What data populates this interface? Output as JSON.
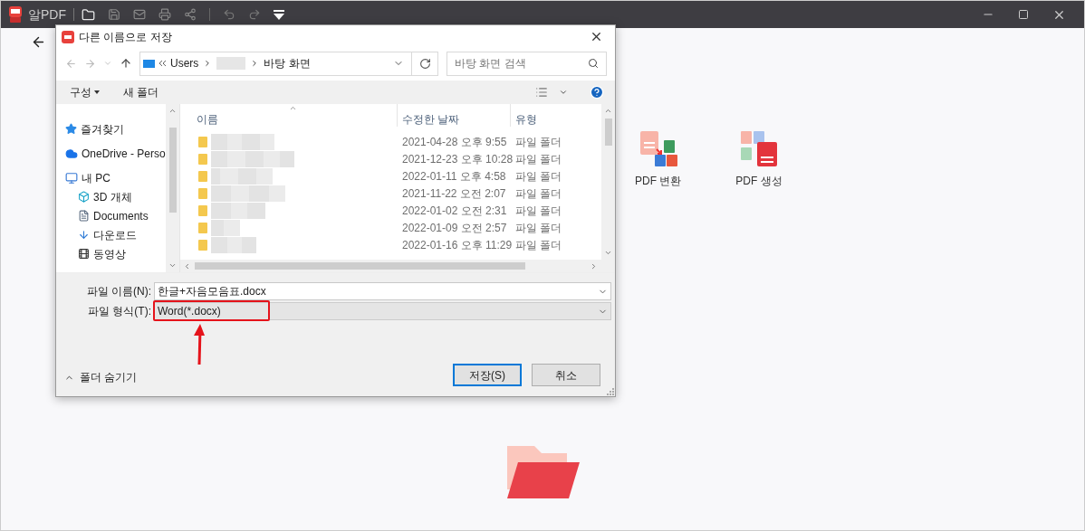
{
  "app": {
    "name": "알PDF"
  },
  "home": {
    "features": [
      {
        "kind": "convert",
        "label": "PDF 변환"
      },
      {
        "kind": "create",
        "label": "PDF 생성"
      }
    ]
  },
  "dialog": {
    "title": "다른 이름으로 저장",
    "breadcrumb": [
      "Users",
      "바탕 화면"
    ],
    "search_placeholder": "바탕 화면 검색",
    "toolbar": {
      "organize": "구성",
      "new_folder": "새 폴더"
    },
    "nav": [
      {
        "kind": "favorites",
        "label": "즐겨찾기"
      },
      {
        "kind": "cloud",
        "label": "OneDrive - Perso"
      },
      {
        "kind": "pc",
        "label": "내 PC",
        "children": [
          {
            "kind": "cube",
            "label": "3D 개체"
          },
          {
            "kind": "documents",
            "label": "Documents"
          },
          {
            "kind": "downloads",
            "label": "다운로드"
          },
          {
            "kind": "videos",
            "label": "동영상"
          }
        ]
      }
    ],
    "columns": [
      "이름",
      "수정한 날짜",
      "유형"
    ],
    "rows": [
      {
        "modified": "2021-04-28 오후 9:55",
        "type": "파일 폴더"
      },
      {
        "modified": "2021-12-23 오후 10:28",
        "type": "파일 폴더"
      },
      {
        "modified": "2022-01-11 오후 4:58",
        "type": "파일 폴더"
      },
      {
        "modified": "2021-11-22 오전 2:07",
        "type": "파일 폴더"
      },
      {
        "modified": "2022-01-02 오전 2:31",
        "type": "파일 폴더"
      },
      {
        "modified": "2022-01-09 오전 2:57",
        "type": "파일 폴더"
      },
      {
        "modified": "2022-01-16 오후 11:29",
        "type": "파일 폴더"
      }
    ],
    "file_name": {
      "label": "파일 이름(N):",
      "value": "한글+자음모음표.docx"
    },
    "file_type": {
      "label": "파일 형식(T):",
      "value": "Word(*.docx)",
      "highlighted": true
    },
    "hide_folders": "폴더 숨기기",
    "buttons": [
      {
        "label": "저장(S)",
        "primary": true
      },
      {
        "label": "취소",
        "primary": false
      }
    ]
  }
}
